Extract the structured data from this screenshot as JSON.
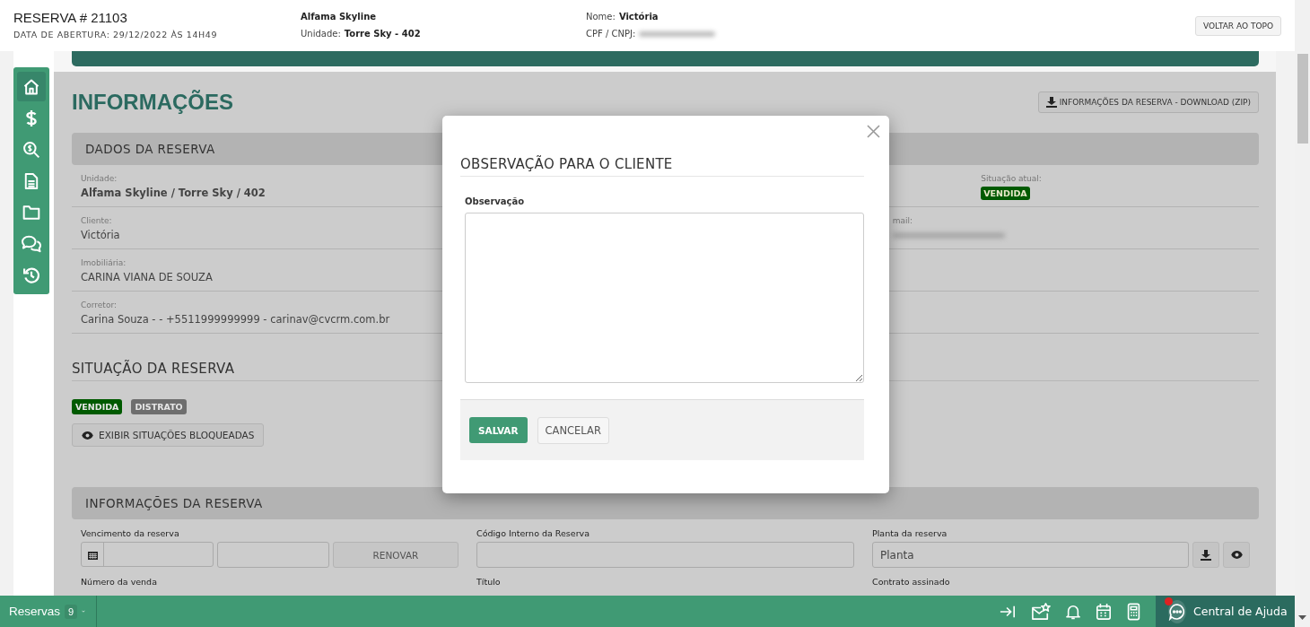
{
  "header": {
    "title": "RESERVA # 21103",
    "opened": "DATA DE ABERTURA: 29/12/2022 ÀS 14H49",
    "project": "Alfama Skyline",
    "unit_label": "Unidade:",
    "unit_value": "Torre Sky - 402",
    "name_label": "Nome:",
    "name_value": "Victória",
    "cpf_label": "CPF / CNPJ:",
    "back_button": "VOLTAR AO TOPO"
  },
  "sidebar": {
    "items": [
      {
        "kind": "home",
        "selected": true
      },
      {
        "kind": "dollar",
        "selected": false
      },
      {
        "kind": "money-search",
        "selected": false
      },
      {
        "kind": "document",
        "selected": false
      },
      {
        "kind": "folder",
        "selected": false
      },
      {
        "kind": "chat",
        "selected": false
      },
      {
        "kind": "history",
        "selected": false
      }
    ]
  },
  "page_title": "INFORMAÇÕES",
  "download_button": "INFORMAÇÕES DA RESERVA - DOWNLOAD (ZIP)",
  "reservation_data": {
    "heading": "DADOS DA RESERVA",
    "rows": [
      {
        "fields": [
          {
            "label": "Unidade:",
            "kind": "bold",
            "value": "Alfama Skyline / Torre Sky / 402"
          },
          {
            "label": "Situação atual:",
            "kind": "badge",
            "value": "VENDIDA"
          }
        ]
      },
      {
        "fields": [
          {
            "label": "Cliente:",
            "kind": "text",
            "value": "Victória"
          },
          {
            "label": "mail:",
            "kind": "redacted"
          }
        ]
      },
      {
        "fields": [
          {
            "label": "Imobiliária:",
            "kind": "text",
            "value": "CARINA VIANA DE SOUZA"
          }
        ]
      },
      {
        "fields": [
          {
            "label": "Corretor:",
            "kind": "text",
            "value": "Carina Souza - - +5511999999999 - carinav@cvcrm.com.br"
          }
        ]
      }
    ]
  },
  "status": {
    "heading": "SITUAÇÃO DA RESERVA",
    "badges": [
      {
        "label": "VENDIDA",
        "color": "#005a00"
      },
      {
        "label": "DISTRATO",
        "color": "#6e6e6e"
      }
    ],
    "show_blocked_button": "EXIBIR SITUAÇÕES BLOQUEADAS"
  },
  "reservation_info": {
    "heading": "INFORMAÇÕES DA RESERVA",
    "fields": [
      {
        "kind": "date-renew",
        "label": "Vencimento da reserva",
        "button": "RENOVAR"
      },
      {
        "kind": "input",
        "label": "Código Interno da Reserva"
      },
      {
        "kind": "file",
        "label": "Planta da reserva",
        "value": "Planta"
      },
      {
        "kind": "label",
        "label": "Número da venda"
      },
      {
        "kind": "label",
        "label": "Título"
      },
      {
        "kind": "label",
        "label": "Contrato assinado"
      }
    ]
  },
  "modal": {
    "title": "OBSERVAÇÃO PARA O CLIENTE",
    "field_label": "Observação",
    "save_button": "SALVAR",
    "cancel_button": "CANCELAR"
  },
  "bottom_bar": {
    "label": "Reservas",
    "count": "9",
    "icons": [
      {
        "kind": "exit"
      },
      {
        "kind": "mail-star"
      },
      {
        "kind": "bell"
      },
      {
        "kind": "calendar"
      },
      {
        "kind": "calculator"
      }
    ],
    "help": {
      "label": "Central de Ajuda",
      "notification": true
    }
  }
}
